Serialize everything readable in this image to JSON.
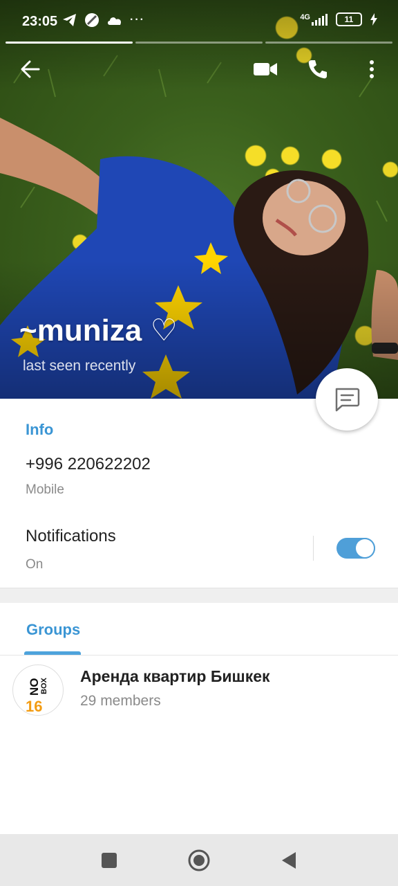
{
  "status_bar": {
    "time": "23:05",
    "notification_icons": [
      "telegram-icon",
      "compass-icon",
      "cloud-icon",
      "more-dots-icon"
    ],
    "network": "4G",
    "battery": "11"
  },
  "story": {
    "segments": 3,
    "active_segment": 1
  },
  "profile": {
    "name": "~muniza ♡",
    "status": "last seen recently"
  },
  "header_actions": [
    "back-arrow-icon",
    "video-call-icon",
    "phone-icon",
    "more-vertical-icon"
  ],
  "info": {
    "title": "Info",
    "phone": "+996 220622202",
    "phone_label": "Mobile",
    "notifications_label": "Notifications",
    "notifications_value": "On",
    "notifications_enabled": true
  },
  "groups": {
    "tab_label": "Groups",
    "items": [
      {
        "name": "Аренда квартир Бишкек",
        "members": "29 members",
        "avatar_text": [
          "NO",
          "BOX",
          "16"
        ]
      }
    ]
  },
  "colors": {
    "accent": "#3a95d4",
    "toggle_on": "#4f9fd8",
    "shirt_blue": "#1f47b5",
    "star_yellow": "#ffd400"
  },
  "navigation": [
    "recents-square-icon",
    "home-circle-icon",
    "back-triangle-icon"
  ]
}
